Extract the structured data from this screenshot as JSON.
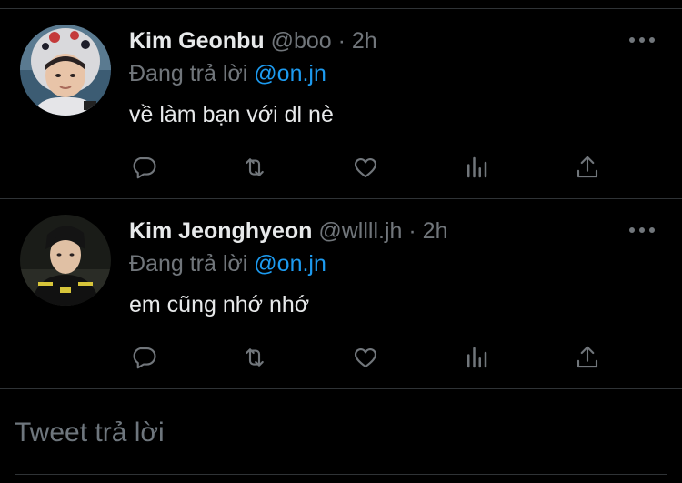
{
  "tweets": [
    {
      "name": "Kim Geonbu",
      "handle": "@boo",
      "separator": "·",
      "time": "2h",
      "replying_prefix": "Đang trả lời",
      "replying_to": "@on.jn",
      "text": "về làm bạn với dl nè"
    },
    {
      "name": "Kim Jeonghyeon",
      "handle": "@wllll.jh",
      "separator": "·",
      "time": "2h",
      "replying_prefix": "Đang trả lời",
      "replying_to": "@on.jn",
      "text": "em cũng nhớ nhớ"
    }
  ],
  "reply_box": {
    "placeholder": "Tweet trả lời"
  },
  "icons": [
    "more-icon",
    "reply-icon",
    "retweet-icon",
    "like-icon",
    "analytics-icon",
    "share-icon"
  ],
  "colors": {
    "background": "#000000",
    "text": "#e7e9ea",
    "muted": "#71767b",
    "link": "#1d9bf0",
    "divider": "#2f3336"
  }
}
